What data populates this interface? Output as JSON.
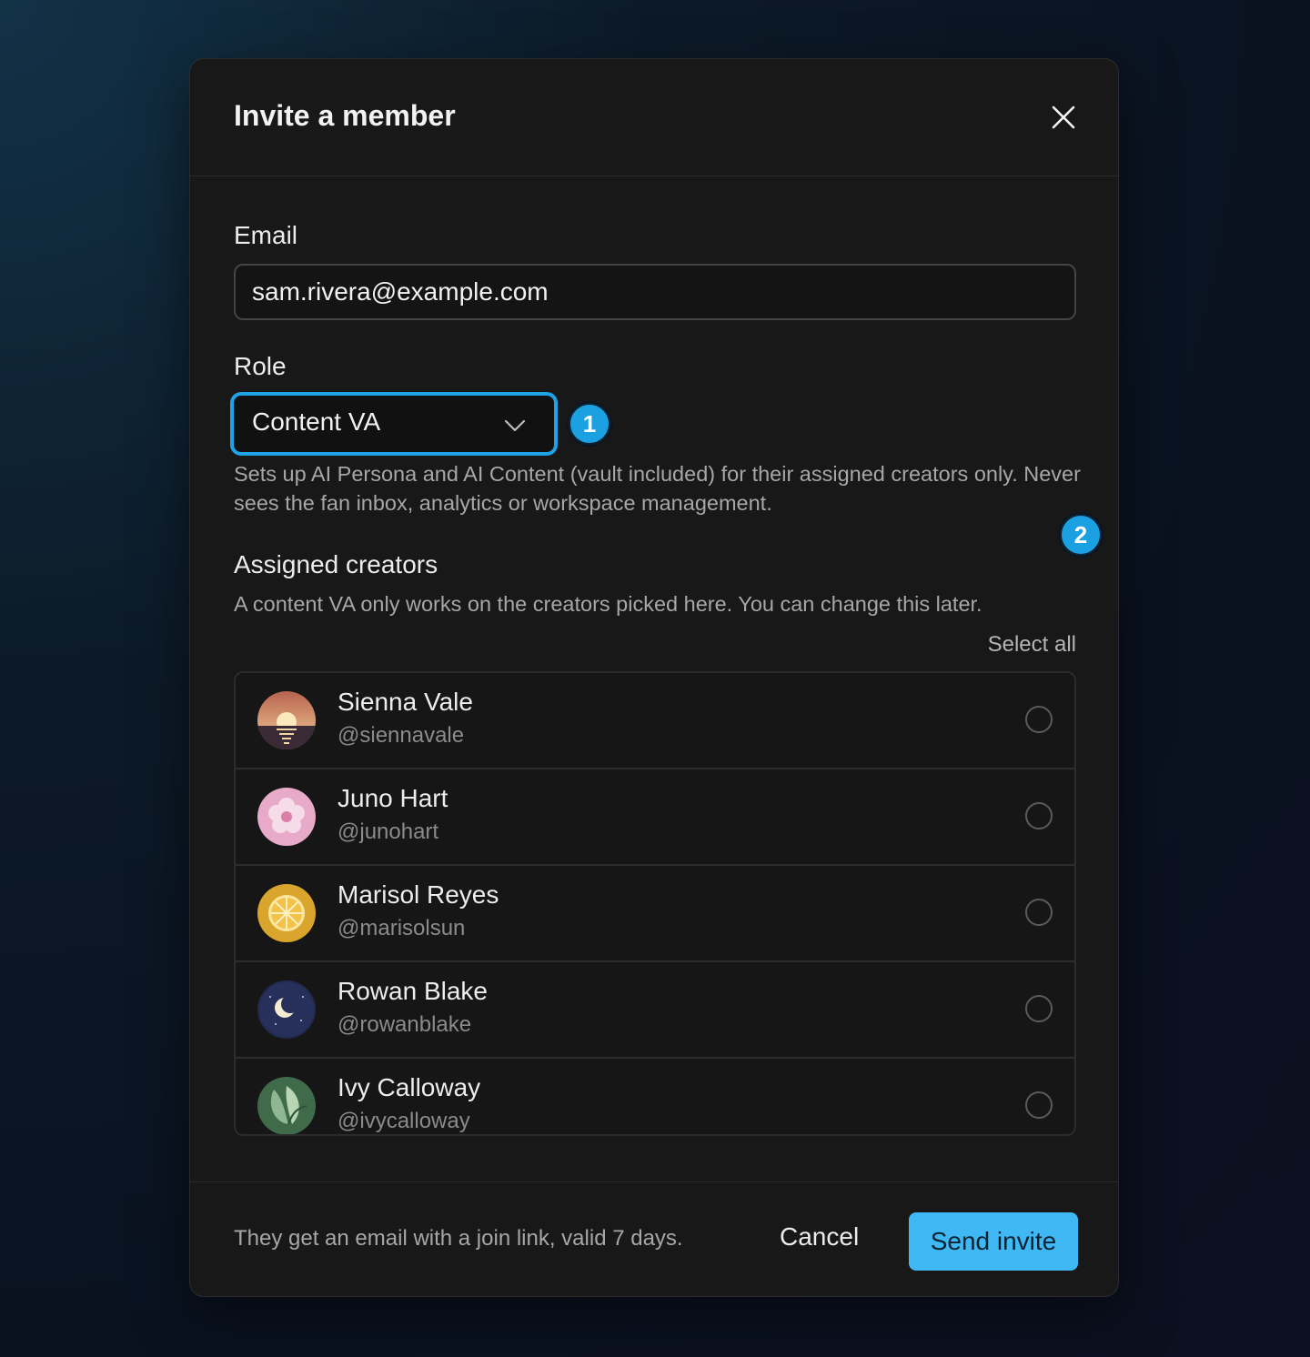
{
  "dialog": {
    "title": "Invite a member"
  },
  "email": {
    "label": "Email",
    "value": "sam.rivera@example.com"
  },
  "role": {
    "label": "Role",
    "selected": "Content VA",
    "description": "Sets up AI Persona and AI Content (vault included) for their assigned creators only. Never sees the fan inbox, analytics or workspace management."
  },
  "markers": {
    "one": "1",
    "two": "2"
  },
  "creators": {
    "title": "Assigned creators",
    "subtitle": "A content VA only works on the creators picked here. You can change this later.",
    "select_all": "Select all",
    "items": [
      {
        "name": "Sienna Vale",
        "handle": "@siennavale",
        "selected": false
      },
      {
        "name": "Juno Hart",
        "handle": "@junohart",
        "selected": false
      },
      {
        "name": "Marisol Reyes",
        "handle": "@marisolsun",
        "selected": false
      },
      {
        "name": "Rowan Blake",
        "handle": "@rowanblake",
        "selected": false
      },
      {
        "name": "Ivy Calloway",
        "handle": "@ivycalloway",
        "selected": false
      }
    ]
  },
  "footer": {
    "note": "They get an email with a join link, valid 7 days.",
    "cancel": "Cancel",
    "send": "Send invite"
  },
  "colors": {
    "accent": "#40b8f4",
    "focus_ring": "#1ea3e6",
    "marker": "#1ba1e2"
  }
}
